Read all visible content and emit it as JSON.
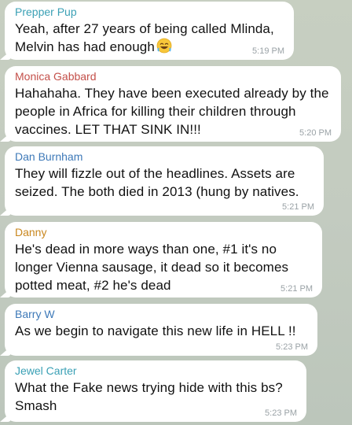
{
  "colors": {
    "chat_background": "#c5cdc1",
    "bubble": "#ffffff",
    "text": "#111111",
    "timestamp": "#9aa2a6"
  },
  "messages": [
    {
      "sender": "Prepper Pup",
      "sender_color": "#3aa0b5",
      "text": "Yeah, after 27 years of being called Mlinda, Melvin has had enough",
      "emoji": "rolling-on-the-floor-laughing-emoji",
      "time": "5:19 PM"
    },
    {
      "sender": "Monica Gabbard",
      "sender_color": "#c4504a",
      "text": "Hahahaha. They have been executed already by the people in Africa for killing their children through vaccines.  LET THAT SINK IN!!!",
      "time": "5:20 PM"
    },
    {
      "sender": "Dan Burnham",
      "sender_color": "#3e79b8",
      "text": "They will fizzle out of the headlines. Assets are seized. The both died in 2013 (hung by natives.",
      "time": "5:21 PM"
    },
    {
      "sender": "Danny",
      "sender_color": "#c9871e",
      "text": "He's dead in more ways than one, #1 it's no longer Vienna sausage, it dead so it becomes potted meat, #2 he's dead",
      "time": "5:21 PM"
    },
    {
      "sender": "Barry W",
      "sender_color": "#3e79b8",
      "text": "As we begin to navigate this new life in HELL !!",
      "time": "5:23 PM"
    },
    {
      "sender": "Jewel Carter",
      "sender_color": "#3aa0b5",
      "text": "What the Fake news trying hide with this bs? Smash",
      "time": "5:23 PM"
    }
  ]
}
